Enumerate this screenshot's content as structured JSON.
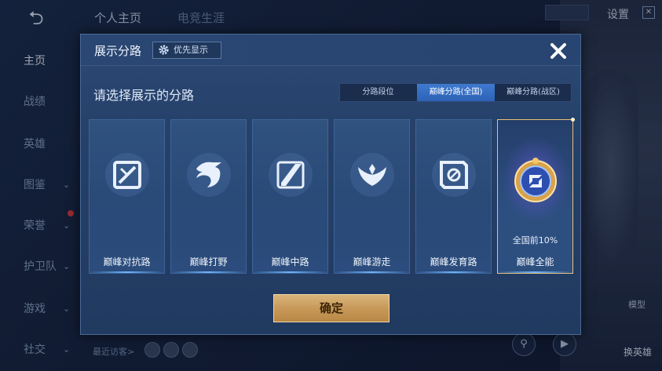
{
  "background": {
    "sidebar": {
      "items": [
        {
          "label": "主页",
          "active": true
        },
        {
          "label": "战绩"
        },
        {
          "label": "英雄"
        },
        {
          "label": "图鉴",
          "has_chevron": true
        },
        {
          "label": "荣誉",
          "has_chevron": true
        },
        {
          "label": "护卫队",
          "has_chevron": true
        },
        {
          "label": "游戏",
          "has_chevron": true
        },
        {
          "label": "社交",
          "has_chevron": true
        }
      ]
    },
    "top_tabs": [
      "个人主页",
      "电竞生涯"
    ],
    "settings_label": "设置",
    "recent_visitors_label": "最近访客>",
    "model_label": "模型",
    "swap_hero_label": "换英雄"
  },
  "modal": {
    "title": "展示分路",
    "priority_label": "优先显示",
    "prompt": "请选择展示的分路",
    "tabs": [
      {
        "label": "分路段位",
        "active": false
      },
      {
        "label": "巅峰分路(全国)",
        "active": true
      },
      {
        "label": "巅峰分路(战区)",
        "active": false
      }
    ],
    "cards": [
      {
        "label": "巅峰对抗路",
        "icon": "sword-cross-icon"
      },
      {
        "label": "巅峰打野",
        "icon": "dragon-icon"
      },
      {
        "label": "巅峰中路",
        "icon": "slash-icon"
      },
      {
        "label": "巅峰游走",
        "icon": "wings-icon"
      },
      {
        "label": "巅峰发育路",
        "icon": "target-icon"
      },
      {
        "label": "巅峰全能",
        "icon": "gold-emblem-icon",
        "subtitle": "全国前10%",
        "selected": true
      }
    ],
    "confirm_label": "确定"
  },
  "colors": {
    "accent_blue": "#2d62b6",
    "gold": "#c7995a",
    "selected_border": "#e9c17a"
  }
}
